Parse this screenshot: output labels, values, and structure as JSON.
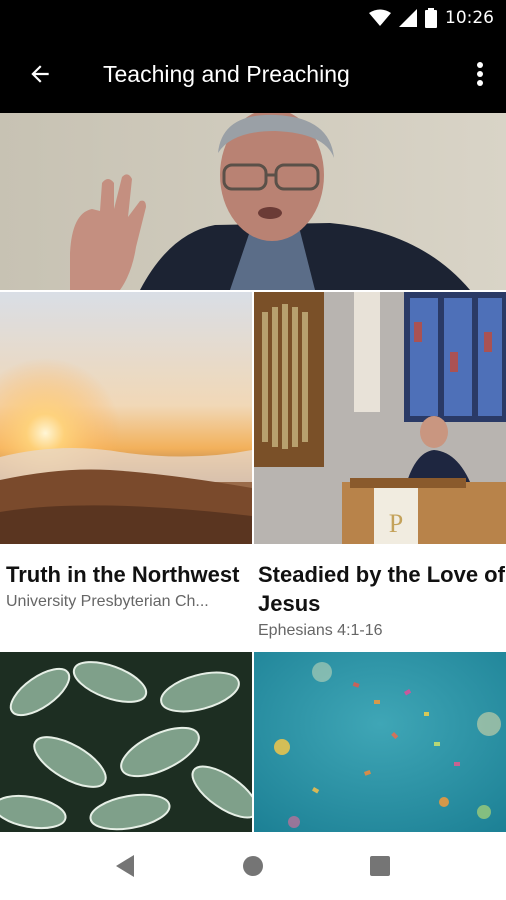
{
  "status_bar": {
    "time": "10:26",
    "icons": [
      "wifi-icon",
      "cell-signal-icon",
      "battery-icon"
    ]
  },
  "app_bar": {
    "title": "Teaching and Preaching",
    "back_icon": "arrow-left-icon",
    "menu_icon": "more-vert-icon"
  },
  "grid": {
    "hero": {
      "image": "speaker-photo"
    },
    "items": [
      {
        "title": "Truth in the Northwest",
        "subtitle": "University Presbyterian Ch...",
        "image": "sunrise-photo"
      },
      {
        "title": "Steadied by the Love of Jesus",
        "subtitle": "Ephesians 4:1-16",
        "image": "pulpit-photo"
      },
      {
        "image": "leaves-photo"
      },
      {
        "image": "confetti-photo"
      }
    ]
  },
  "nav_bar": {
    "buttons": [
      "back-triangle-icon",
      "home-circle-icon",
      "recents-square-icon"
    ]
  }
}
